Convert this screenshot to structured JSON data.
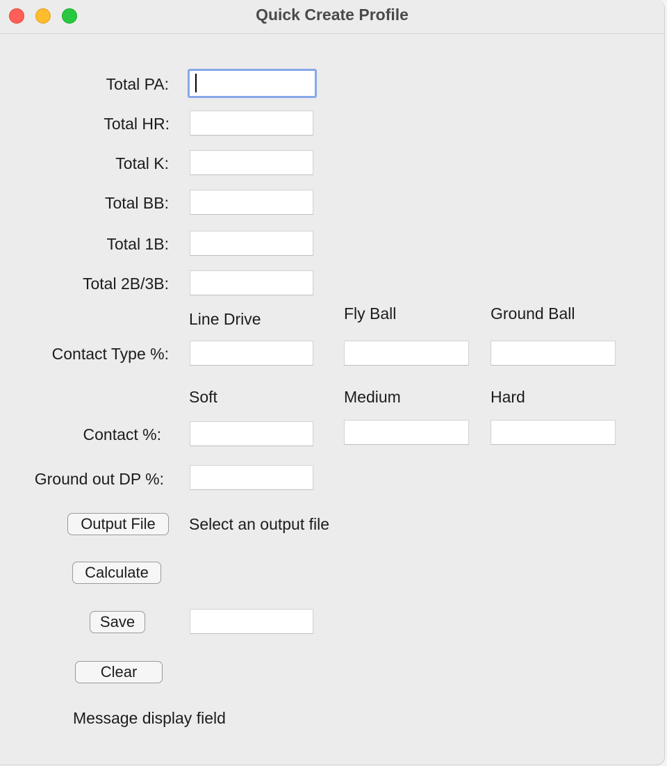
{
  "window": {
    "title": "Quick Create Profile"
  },
  "form": {
    "total_pa_label": "Total PA:",
    "total_hr_label": "Total HR:",
    "total_k_label": "Total K:",
    "total_bb_label": "Total BB:",
    "total_1b_label": "Total 1B:",
    "total_2b3b_label": "Total 2B/3B:",
    "contact_type": {
      "label": "Contact Type %:",
      "line_drive": "Line Drive",
      "fly_ball": "Fly Ball",
      "ground_ball": "Ground Ball"
    },
    "contact": {
      "label": "Contact %:",
      "soft": "Soft",
      "medium": "Medium",
      "hard": "Hard"
    },
    "ground_out_dp_label": "Ground out DP %:",
    "values": {
      "total_pa": "",
      "total_hr": "",
      "total_k": "",
      "total_bb": "",
      "total_1b": "",
      "total_2b3b": "",
      "line_drive": "",
      "fly_ball": "",
      "ground_ball": "",
      "soft": "",
      "medium": "",
      "hard": "",
      "ground_out_dp": "",
      "save_name": ""
    }
  },
  "actions": {
    "output_file_label": "Output File",
    "output_file_status": "Select an output file",
    "calculate_label": "Calculate",
    "save_label": "Save",
    "clear_label": "Clear"
  },
  "message": "Message display field",
  "colors": {
    "close": "#ff5f57",
    "minimize": "#febc2e",
    "maximize": "#28c840",
    "focus_ring": "#86a8e8"
  }
}
